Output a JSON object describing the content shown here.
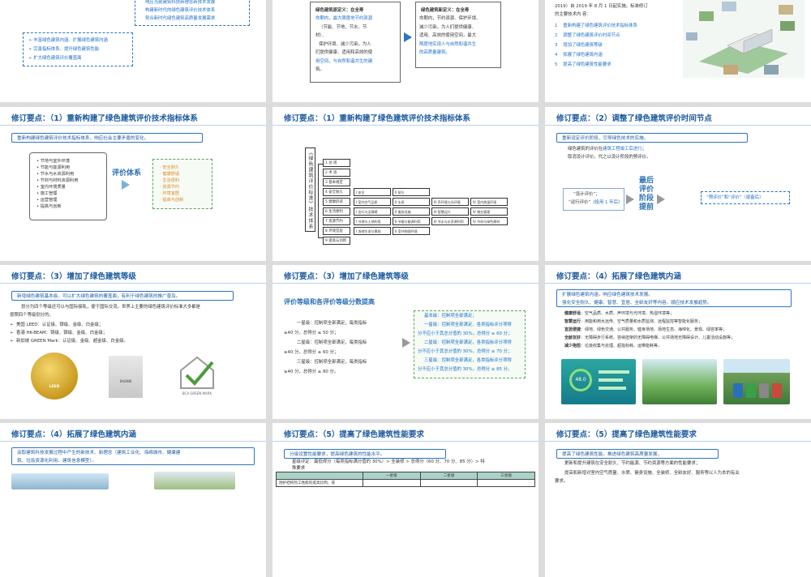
{
  "s00": {
    "lines_blue": [
      "响应当前建筑科技新理念新技术发展",
      "构建新时代的绿色建筑评价技术体系",
      "契合新时代绿色建筑高质量发展需求"
    ],
    "lines_orange": [
      "丰富绿色建筑内涵、扩展绿色建筑内涵",
      "完善指标体系、提升绿色建筑性能",
      "扩大绿色建筑评价覆盖面"
    ]
  },
  "s01": {
    "old_def": [
      "绿色建筑原定义：在全寿",
      "命期内，最大限度地节约资源",
      "（节能、节地、节水、节",
      "材）、",
      "保护环境、减少污染，为人",
      "们提供健康、适用和高效的使",
      "用空间，与自然和谐共生的建",
      "筑。"
    ],
    "new_def": [
      "绿色建筑新定义：在全寿",
      "命期内，节约资源、保护环境、",
      "减少污染，为人们提供健康、",
      "适用、高效的使用空间，最大",
      "限度地实现人与自然和谐共生",
      "的高质量建筑。"
    ]
  },
  "s02": {
    "intro": [
      "2019）自 2019 年 8 月 1 日起实施。标准修订",
      "的主要技术内 容："
    ],
    "items": [
      {
        "num": "1",
        "text": "重新构建了绿色建筑评价技术指标体系"
      },
      {
        "num": "2",
        "text": "调整了绿色建筑评价时间节点"
      },
      {
        "num": "3",
        "text": "增加了绿色建筑等级"
      },
      {
        "num": "4",
        "text": "拓展了绿色建筑内涵"
      },
      {
        "num": "5",
        "text": "提高了绿色建筑性能要求"
      }
    ]
  },
  "s10": {
    "title": "修订要点：（1）重新构建了绿色建筑评价技术指标体系",
    "banner": "重新构建绿色建筑评价技术指标体系，响应社会主要矛盾的变化。",
    "old_items": [
      "节地与室外环境",
      "节能与能源利用",
      "节水与水资源利用",
      "节材与材料资源利用",
      "室内环境质量",
      "施工管理",
      "运营管理",
      "提高与创新"
    ],
    "arrow_label": "评价体系",
    "new_items": [
      "安全耐久",
      "健康舒适",
      "生活便利",
      "资源节约",
      "环境宜居",
      "提高与创新"
    ]
  },
  "s11": {
    "title": "修订要点：（1）重新构建了绿色建筑评价技术指标体系",
    "vtitle": "《绿色建筑评价标准》技术体系",
    "rows": [
      {
        "label": "1 总 则",
        "cells": []
      },
      {
        "label": "2 术 语",
        "cells": []
      },
      {
        "label": "3 基本规定",
        "cells": []
      },
      {
        "label": "4 安全耐久",
        "cells": [
          "I 安全",
          "II 耐久"
        ]
      },
      {
        "label": "5 健康舒适",
        "cells": [
          "I 室内空气品质",
          "II 水质",
          "III 声环境与光环境",
          "IV 室内热湿环境"
        ]
      },
      {
        "label": "6 生活便利",
        "cells": [
          "I 出行与无障碍",
          "II 服务设施",
          "III 智慧运行",
          "IV 物业管理"
        ]
      },
      {
        "label": "7 资源节约",
        "cells": [
          "I 节地与土地利用",
          "II 节能与能源利用",
          "III 节水与水资源利用",
          "IV 节材与绿色建材"
        ]
      },
      {
        "label": "8 环境宜居",
        "cells": [
          "I 场地生态与景观",
          "II 室外物理环境"
        ]
      },
      {
        "label": "9 提高与创新",
        "cells": []
      }
    ]
  },
  "s12": {
    "title": "修订要点：（2）调整了绿色建筑评价时间节点",
    "banner": "重新设定评价阶段，引导绿色技术的实施。",
    "line1_pre": "绿色建筑的评价在",
    "line1_blue": "建筑工程竣工后进行",
    "line1_post": "；",
    "line2": "取消设计评价，代之以设计阶段的预评价。",
    "old_stage1": "“设计评价”；",
    "old_stage2_pre": "“运行评价”（",
    "old_stage2_blue": "投用 1 年后",
    "old_stage2_post": "）",
    "mid_label": [
      "最后",
      "评价",
      "阶段",
      "提前"
    ],
    "new_stage": "“预评价”和“评价”（竣备后）"
  },
  "s20": {
    "title": "修订要点：（3）增加了绿色建筑等级",
    "banner": "新增绿色建筑基本级，可以扩大绿色建筑的覆盖面，有利于绿色建筑的推广普及。",
    "para": [
      "划分为四个等级还可以与国际接轨，便于国际交流。世界上主要的绿色建筑评价标准大多都是",
      "按照四个等级划分的。"
    ],
    "intl": [
      "美国 LEED：认证级、银级、金级、白金级；",
      "香港 HK-BEAM：铜级、银级、金级、白金级；",
      "新加坡 GREEN Mark：认证级、金级、超金级、白金级。"
    ],
    "logos": [
      "LEED",
      "DGNB",
      "BCA GREEN MARK"
    ]
  },
  "s21": {
    "title": "修订要点：（3）增加了绿色建筑等级",
    "subtitle": "评价等级和各评价等级分数提高",
    "old": [
      "一星级：控制项全部满足，每类指标",
      "≥40 分，总得分 ≥ 50 分；",
      "二星级：控制项全部满足，每类指标",
      "≥40 分，总得分 ≥ 60 分；",
      "三星级：控制项全部满足，每类指标",
      "≥40 分，总得分 ≥ 80 分。"
    ],
    "new": [
      "基本级：控制项全部满足；",
      "一星级：控制项全部满足、各类指标评分项得",
      "分不应小于其总分值的 30%，总得分 ≥ 60 分；",
      "二星级：控制项全部满足，各类指标评分项得",
      "分不应小于其总分值的 30%，总得分 ≥ 70 分；",
      "三星级：控制项全部满足，各类指标评分项得",
      "分不应小于其总分值的 30%，总得分 ≥ 85 分。"
    ]
  },
  "s22": {
    "title": "修订要点：（4）拓展了绿色建筑内涵",
    "banner_lines": [
      "扩展绿色建筑内涵，响应绿色建筑技术发展。",
      "强化安全耐久、健康、智慧、宜居、全龄友好等内容，顺应技术发展趋势。"
    ],
    "items": [
      {
        "k": "健康舒适",
        "v": "：空气品质、水质、声环境与光环境、热湿环境等；"
      },
      {
        "k": "智慧运行",
        "v": "：用能和用水远传、空气质量和水质监测、远程监控等智能化服务；"
      },
      {
        "k": "宜居便捷",
        "v": "：绿地、绿色交通、公共服务、健身场地、场地生态、海绵化、景观、绿容率等；"
      },
      {
        "k": "全龄友好",
        "v": "：无障碍步行系统、容纳担架的无障碍电梯、公共场地无障碍设计、儿童活动设施等；"
      },
      {
        "k": "减少抱怨",
        "v": "：垃圾收集与处理、超指标耗、运带能耗等。"
      }
    ],
    "gauge": "48.0"
  },
  "s30": {
    "title": "修订要点：（4）拓展了绿色建筑内涵",
    "banner": [
      "汲取建筑科技发展过程中产生的新技术、新理念（建筑工业化、海绵城市、健康建",
      "筑、垃圾资源化利用、建筑信息模型）。"
    ]
  },
  "s31": {
    "title": "修订要点：（5）提高了绿色建筑性能要求",
    "banner": "分级设置性能要求，提高绿色建筑的性能水平。",
    "line": "星级评定：最低得分（每类指标满分值的 30%）> 全装修 > 总得分（60 分、70 分、85 分）> 特",
    "line2": "殊要求",
    "headers": [
      "",
      "一星级",
      "二星级",
      "三星级"
    ],
    "row1": "围护结构热工性能的提高比例，或"
  },
  "s32": {
    "title": "修订要点：（5）提高了绿色建筑性能要求",
    "banner": "提高了绿色建筑性能，推进绿色建筑高质量发展。",
    "lines": [
      "更新和提升建筑在安全耐久、节约能源、节约资源等方面的性能要求；",
      "提高和新增对室内空气质量、水质、健身设施、全装修、全龄友好、服务等以人为本的有关",
      "要求。"
    ]
  }
}
